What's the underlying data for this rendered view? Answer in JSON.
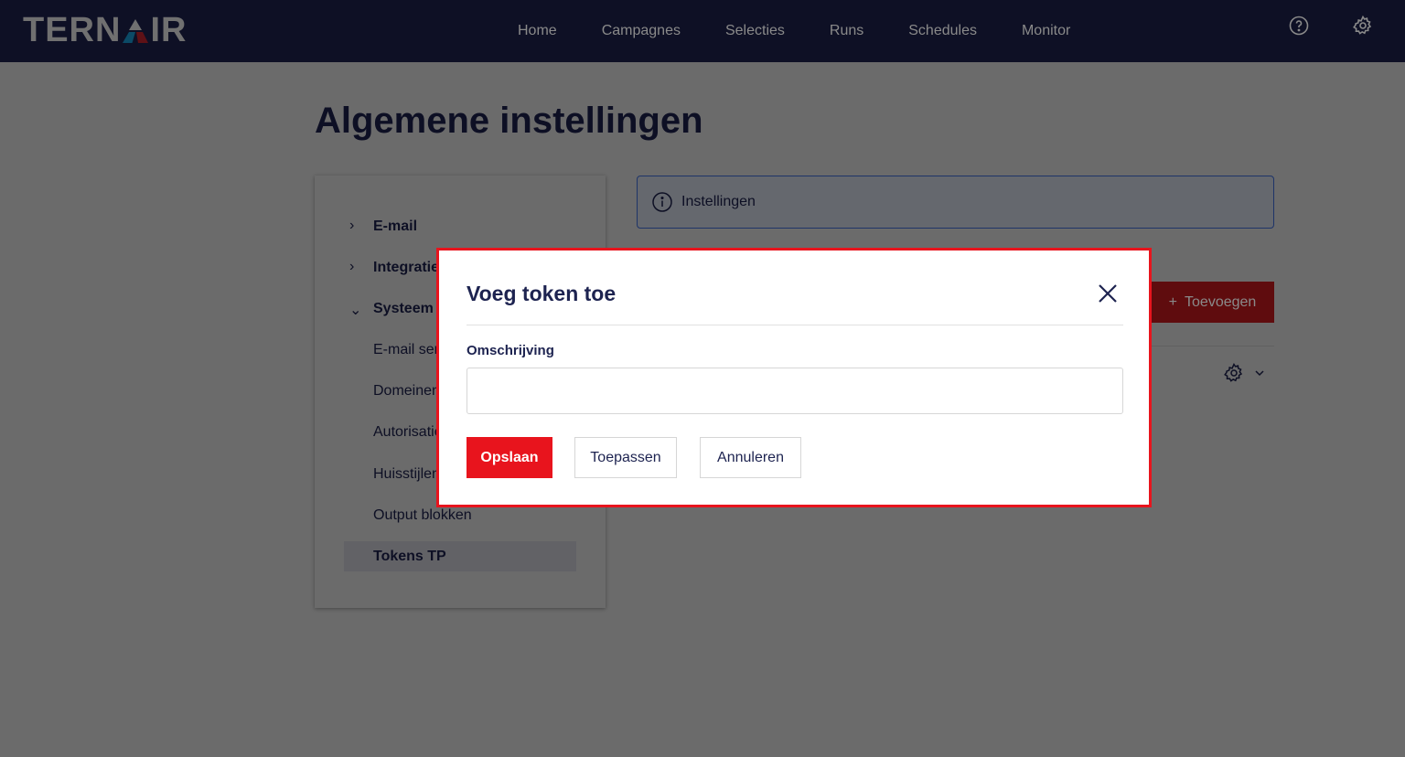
{
  "nav": {
    "logo": "TERNAIR",
    "items": [
      "Home",
      "Campagnes",
      "Selecties",
      "Runs",
      "Schedules",
      "Monitor"
    ]
  },
  "page": {
    "title": "Algemene instellingen"
  },
  "sidebar": {
    "items": [
      {
        "label": "E-mail"
      },
      {
        "label": "Integraties"
      },
      {
        "label": "Systeem"
      },
      {
        "label": "E-mail server"
      },
      {
        "label": "Domeinen"
      },
      {
        "label": "Autorisatie"
      },
      {
        "label": "Huisstijlen"
      },
      {
        "label": "Output blokken"
      },
      {
        "label": "Tokens TP"
      }
    ]
  },
  "info": {
    "label": "Instellingen"
  },
  "toolbar": {
    "add_label": "Toevoegen"
  },
  "modal": {
    "title": "Voeg token toe",
    "field_label": "Omschrijving",
    "field_value": "",
    "save": "Opslaan",
    "apply": "Toepassen",
    "cancel": "Annuleren"
  }
}
